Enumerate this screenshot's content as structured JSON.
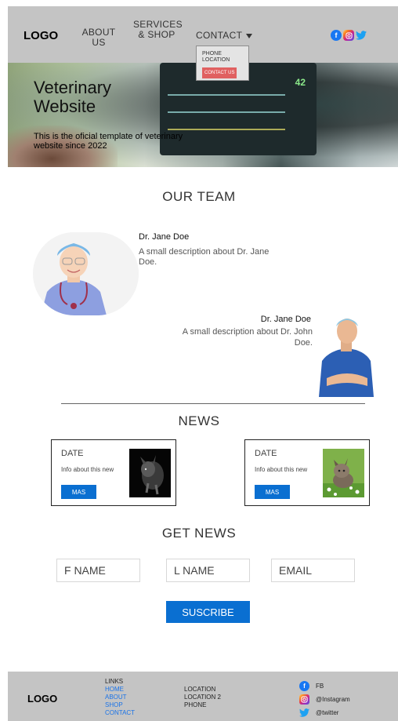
{
  "header": {
    "logo": "LOGO",
    "nav": {
      "about": "ABOUT US",
      "services": "SERVICES & SHOP",
      "contact": "CONTACT"
    },
    "social_icons": [
      "facebook-icon",
      "instagram-icon",
      "twitter-icon"
    ]
  },
  "dropdown": {
    "items": [
      "PHONE",
      "LOCATION"
    ],
    "button": "CONTACT US"
  },
  "hero": {
    "monitor_value": "42",
    "title_line1": "Veterinary",
    "title_line2": "Website",
    "subtitle": "This is the oficial template of veterinary website since 2022"
  },
  "team": {
    "title": "OUR TEAM",
    "members": [
      {
        "name": "Dr.  Jane Doe",
        "desc": "A small description about Dr. Jane Doe."
      },
      {
        "name": "Dr.  Jane Doe",
        "desc": "A small description about Dr. John Doe."
      }
    ]
  },
  "news": {
    "title": "NEWS",
    "cards": [
      {
        "date": "DATE",
        "info": "Info about this new",
        "button": "MAS"
      },
      {
        "date": "DATE",
        "info": "Info about this new",
        "button": "MAS"
      }
    ]
  },
  "signup": {
    "title": "GET NEWS",
    "first_name": "F NAME",
    "last_name": "L NAME",
    "email": "EMAIL",
    "button": "SUSCRIBE"
  },
  "footer": {
    "logo": "LOGO",
    "links_title": "LINKS",
    "links": [
      "HOME",
      "ABOUT",
      "SHOP",
      "CONTACT"
    ],
    "locations": [
      "LOCATION",
      "LOCATION 2",
      "PHONE"
    ],
    "social": [
      {
        "icon": "facebook-icon",
        "label": "FB"
      },
      {
        "icon": "instagram-icon",
        "label": "@Instagram"
      },
      {
        "icon": "twitter-icon",
        "label": "@twitter"
      }
    ]
  },
  "colors": {
    "accent": "#0a6fd1",
    "header_bg": "#c4c4c4",
    "dropdown_button": "#e06060"
  }
}
